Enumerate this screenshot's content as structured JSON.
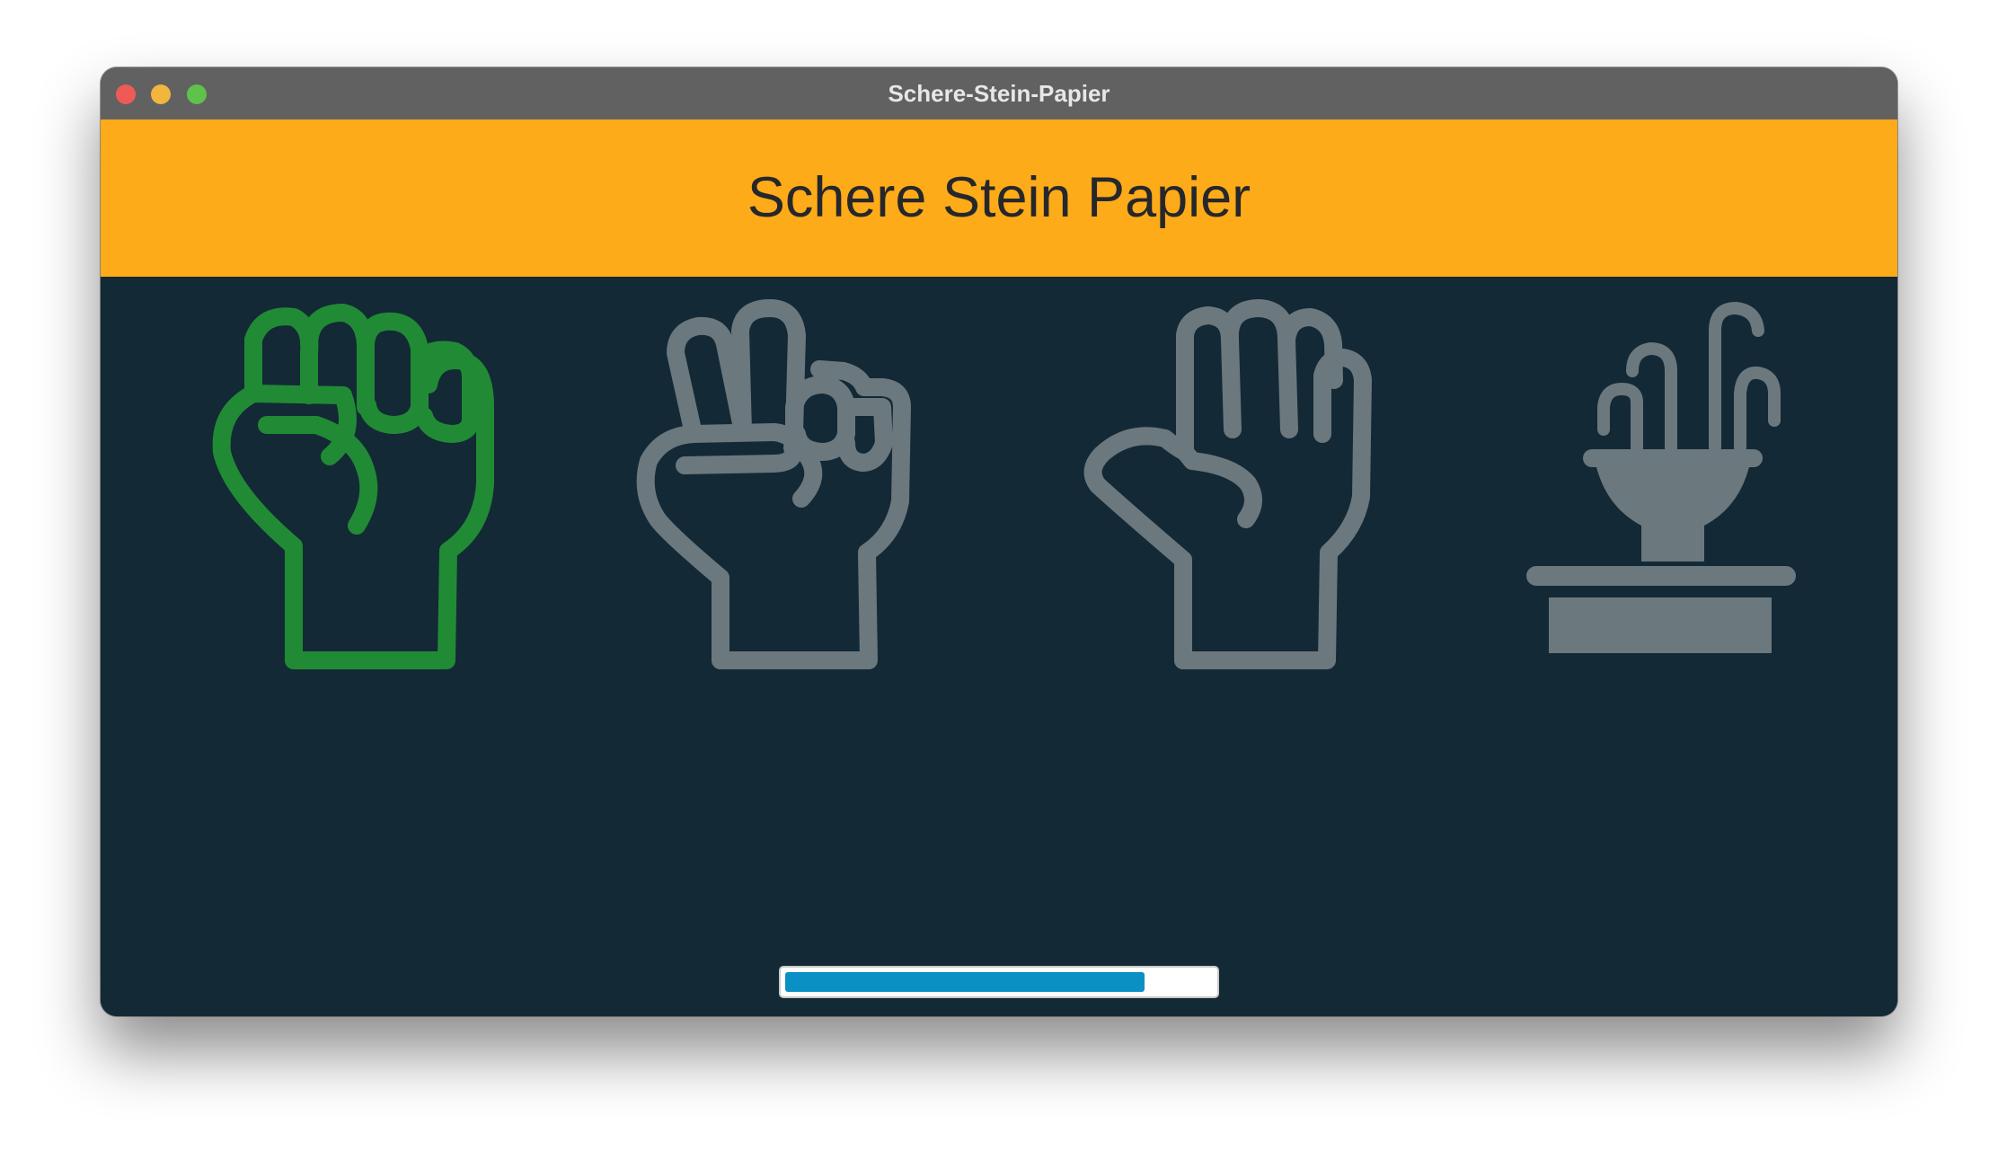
{
  "window": {
    "title": "Schere-Stein-Papier"
  },
  "header": {
    "title": "Schere Stein Papier",
    "background": "#feab19"
  },
  "choices": [
    {
      "name": "stein",
      "icon": "fist-icon",
      "selected": true,
      "color": "#218a35"
    },
    {
      "name": "schere",
      "icon": "victory-hand-icon",
      "selected": false,
      "color": "#6b787e"
    },
    {
      "name": "papier",
      "icon": "open-hand-icon",
      "selected": false,
      "color": "#6b787e"
    },
    {
      "name": "brunnen",
      "icon": "fountain-icon",
      "selected": false,
      "color": "#6b787e"
    }
  ],
  "progress": {
    "fraction": 0.84,
    "color": "#0b90c6"
  },
  "colors": {
    "background": "#132935",
    "titlebar": "#616161"
  }
}
